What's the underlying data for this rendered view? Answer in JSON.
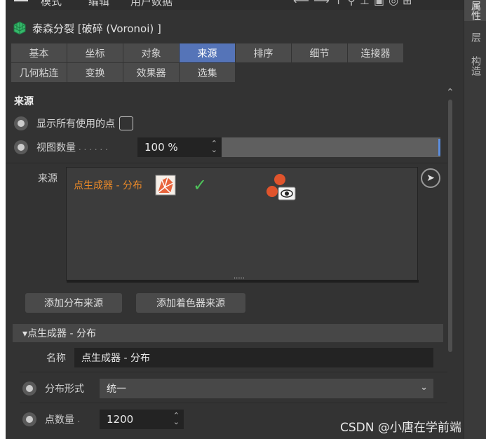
{
  "menubar": {
    "items": [
      "模式",
      "编辑",
      "用户数据"
    ],
    "toolbar_icons": [
      "back-arrow-icon",
      "forward-arrow-icon",
      "up-arrow-icon",
      "search-icon",
      "pin-icon",
      "lock-icon",
      "circle-icon",
      "add-icon"
    ]
  },
  "right_tabs": [
    "属性",
    "层",
    "构造"
  ],
  "object": {
    "title": "泰森分裂 [破碎 (Voronoi) ]",
    "icon": "voronoi-cube-icon"
  },
  "tabs_row1": [
    "基本",
    "坐标",
    "对象",
    "来源",
    "排序",
    "细节",
    "连接器"
  ],
  "tabs_row2": [
    "几何粘连",
    "变换",
    "效果器",
    "选集"
  ],
  "active_tab": "来源",
  "section": {
    "title": "来源"
  },
  "show_points": {
    "label": "显示所有使用的点",
    "checked": false
  },
  "view_count": {
    "label": "视图数量",
    "dots": " . . . . . .",
    "value": "100 %",
    "fraction": 1.0
  },
  "sources": {
    "label": "来源",
    "items": [
      {
        "name": "点生成器 - 分布",
        "enabled": "✓",
        "name_color": "#f08c28",
        "check_color": "#4ec45a"
      }
    ],
    "handle": "....."
  },
  "buttons": {
    "add_distribution": "添加分布来源",
    "add_shader": "添加着色器来源"
  },
  "generator": {
    "header": "▾点生成器 - 分布",
    "name_label": "名称",
    "name_value": "点生成器 - 分布",
    "distribution_label": "分布形式",
    "distribution_value": "统一",
    "count_label": "点数量",
    "count_dots": ".",
    "count_value": "1200"
  },
  "watermark": "CSDN @小唐在学前端",
  "colors": {
    "accent": "#5574b8",
    "panel": "#333333",
    "field": "#232323"
  }
}
